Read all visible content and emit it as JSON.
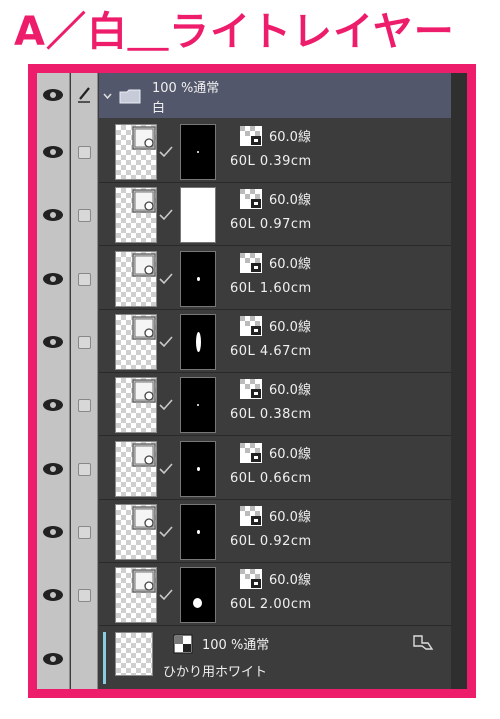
{
  "title": "A／白＿ライトレイヤー",
  "colors": {
    "accent": "#ee1d6b",
    "panel": "#3c3c3c",
    "folder_row": "#53576b",
    "light_bar": "#86cfe3"
  },
  "folder": {
    "opacity_mode": "100 %通常",
    "name": "白",
    "icons": [
      "eye-icon",
      "pen-icon",
      "chevron-down-icon",
      "folder-icon"
    ]
  },
  "layers": [
    {
      "mode": "60.0線",
      "name": "60L 0.39cm",
      "mask_shape": "tiny-dot"
    },
    {
      "mode": "60.0線",
      "name": "60L 0.97cm",
      "mask_shape": "white"
    },
    {
      "mode": "60.0線",
      "name": "60L 1.60cm",
      "mask_shape": "small-dot"
    },
    {
      "mode": "60.0線",
      "name": "60L 4.67cm",
      "mask_shape": "ellipse"
    },
    {
      "mode": "60.0線",
      "name": "60L 0.38cm",
      "mask_shape": "tiny-dot"
    },
    {
      "mode": "60.0線",
      "name": "60L 0.66cm",
      "mask_shape": "small-dot"
    },
    {
      "mode": "60.0線",
      "name": "60L 0.92cm",
      "mask_shape": "small-dot"
    },
    {
      "mode": "60.0線",
      "name": "60L 2.00cm",
      "mask_shape": "large-dot"
    }
  ],
  "light_layer": {
    "opacity_mode": "100 %通常",
    "name": "ひかり用ホワイト"
  }
}
